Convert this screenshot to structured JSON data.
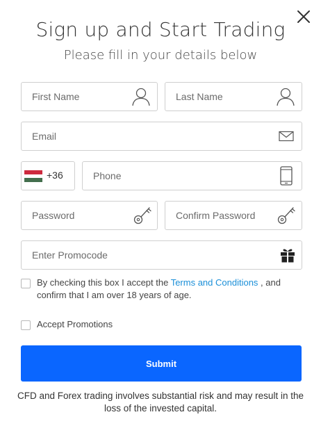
{
  "header": {
    "title": "Sign up and Start Trading",
    "subtitle": "Please fill in your details below"
  },
  "form": {
    "first_name_placeholder": "First Name",
    "last_name_placeholder": "Last Name",
    "email_placeholder": "Email",
    "phone_country_code": "+36",
    "phone_country_flag": "hungary-flag",
    "phone_placeholder": "Phone",
    "password_placeholder": "Password",
    "confirm_password_placeholder": "Confirm Password",
    "promocode_placeholder": "Enter Promocode",
    "terms_prefix": "By checking this box I accept the ",
    "terms_link": "Terms and Conditions",
    "terms_suffix": " , and confirm that I am over 18 years of age.",
    "terms_checked": false,
    "promotions_label": "Accept Promotions",
    "promotions_checked": false,
    "submit_label": "Submit"
  },
  "disclaimer": "CFD and Forex trading involves substantial risk and may result in the loss of the invested capital.",
  "icons": {
    "close": "close-icon",
    "user": "user-icon",
    "email": "envelope-icon",
    "phone": "mobile-phone-icon",
    "password": "key-icon",
    "promo": "gift-icon"
  },
  "colors": {
    "accent": "#0a66ff",
    "link": "#1a8fd8",
    "border": "#cfcfcf",
    "flag_red": "#cd2a3e",
    "flag_white": "#ffffff",
    "flag_green": "#436f4d"
  }
}
